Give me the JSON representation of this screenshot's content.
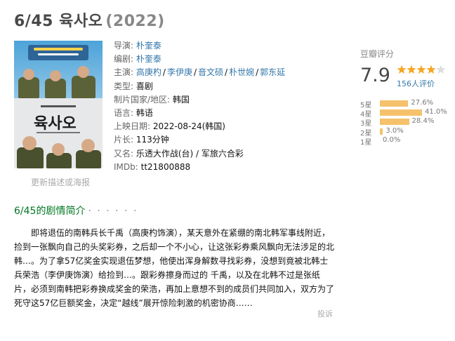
{
  "header": {
    "title": "6/45 육사오",
    "year": "(2022)"
  },
  "poster": {
    "banner_text": "북으로 날아간 57억 로또",
    "logo_text": "육사오",
    "more_link": "更新描述或海报"
  },
  "info": {
    "director_label": "导演:",
    "director": "朴奎泰",
    "writer_label": "编剧:",
    "writer": "朴奎泰",
    "cast_label": "主演:",
    "cast": [
      "高庚杓",
      "李伊庚",
      "音文硕",
      "朴世婉",
      "郭东延"
    ],
    "cast_sep": "/",
    "genre_label": "类型:",
    "genre": "喜剧",
    "country_label": "制片国家/地区:",
    "country": "韩国",
    "language_label": "语言:",
    "language": "韩语",
    "release_label": "上映日期:",
    "release": "2022-08-24(韩国)",
    "runtime_label": "片长:",
    "runtime": "113分钟",
    "aka_label": "又名:",
    "aka": "乐透大作战(台) / 军旅六合彩",
    "imdb_label": "IMDb:",
    "imdb": "tt21800888"
  },
  "rating": {
    "label": "豆瓣评分",
    "score": "7.9",
    "stars_value": 4,
    "stars_max": 5,
    "count_text": "156人评价",
    "star_color": "#f5a623",
    "bar_color": "#f5c26b",
    "bars": [
      {
        "label": "5星",
        "pct": 27.6,
        "pct_text": "27.6%"
      },
      {
        "label": "4星",
        "pct": 41.0,
        "pct_text": "41.0%"
      },
      {
        "label": "3星",
        "pct": 28.4,
        "pct_text": "28.4%"
      },
      {
        "label": "2星",
        "pct": 3.0,
        "pct_text": "3.0%"
      },
      {
        "label": "1星",
        "pct": 0.0,
        "pct_text": "0.0%"
      }
    ]
  },
  "summary": {
    "title": "6/45的剧情简介",
    "dots": "· · · · · ·",
    "text": "即将退伍的南韩兵长千禹（高庚杓饰演），某天意外在紧绷的南北韩军事线附近，捡到一张飘向自己的头奖彩券，之后却一个不小心，让这张彩券乘风飘向无法涉足的北韩…。为了拿57亿奖金实现退伍梦想，他使出浑身解数寻找彩券，没想到竟被北韩士兵荣浩（李伊庚饰演）给捡到…。跟彩券擦身而过的 千禹，以及在北韩不过是张纸片，必须到南韩把彩券换成奖金的荣浩，再加上意想不到的成员们共同加入，双方为了死守这57亿巨额奖金，决定“越线”展开惊险刺激的机密协商……",
    "report": "投诉"
  }
}
